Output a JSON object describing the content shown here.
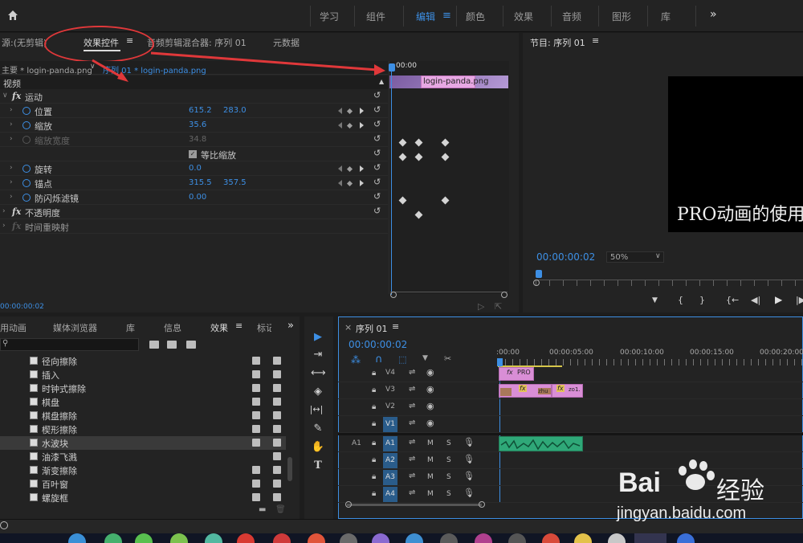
{
  "topbar": {
    "home_icon": "home-icon",
    "workspaces": [
      "学习",
      "组件",
      "编辑",
      "颜色",
      "效果",
      "音频",
      "图形",
      "库"
    ],
    "active_workspace": "编辑",
    "more": "»"
  },
  "source_panel": {
    "tabs": [
      "源:(无剪辑)",
      "效果控件",
      "音频剪辑混合器: 序列 01",
      "元数据"
    ],
    "active_tab": "效果控件",
    "menu_glyph": "≡",
    "master_clip": "主要 * login-panda.png",
    "sequence_clip": "序列 01 * login-panda.png",
    "section_video": "视频",
    "timecode_head": "00:00",
    "clip_name": "login-panda.png",
    "bottom_timecode": "00:00:00:02",
    "properties": {
      "motion": "运动",
      "position": {
        "label": "位置",
        "x": "615.2",
        "y": "283.0"
      },
      "scale": {
        "label": "缩放",
        "value": "35.6"
      },
      "scale_width": {
        "label": "缩放宽度",
        "value": "34.8"
      },
      "uniform_scale": "等比缩放",
      "rotation": {
        "label": "旋转",
        "value": "0.0"
      },
      "anchor": {
        "label": "锚点",
        "x": "315.5",
        "y": "357.5"
      },
      "antiflicker": {
        "label": "防闪烁滤镜",
        "value": "0.00"
      },
      "opacity": "不透明度",
      "time_remap": "时间重映射"
    }
  },
  "program_panel": {
    "title": "节目: 序列 01",
    "menu_glyph": "≡",
    "overlay_text": "PRO动画的使用",
    "timecode": "00:00:00:02",
    "zoom": "50%",
    "transport": [
      "▼",
      "{",
      "}",
      "{←",
      "◀|",
      "▶",
      "|▶"
    ]
  },
  "effects_panel": {
    "tabs": [
      "用动画",
      "媒体浏览器",
      "库",
      "信息",
      "效果",
      "标记"
    ],
    "active_tab": "效果",
    "menu_glyph": "≡",
    "more": "»",
    "items": [
      {
        "name": "径向擦除",
        "badges": 2
      },
      {
        "name": "插入",
        "badges": 2
      },
      {
        "name": "时钟式擦除",
        "badges": 2
      },
      {
        "name": "棋盘",
        "badges": 2
      },
      {
        "name": "棋盘擦除",
        "badges": 2
      },
      {
        "name": "楔形擦除",
        "badges": 2
      },
      {
        "name": "水波块",
        "badges": 2
      },
      {
        "name": "油漆飞溅",
        "badges": 1
      },
      {
        "name": "渐变擦除",
        "badges": 2
      },
      {
        "name": "百叶窗",
        "badges": 2
      },
      {
        "name": "螺旋框",
        "badges": 2
      }
    ],
    "selected": "水波块"
  },
  "timeline": {
    "tab": "序列 01",
    "close": "×",
    "menu_glyph": "≡",
    "timecode": "00:00:00:02",
    "ruler": [
      ":00:00",
      "00:00:05:00",
      "00:00:10:00",
      "00:00:15:00",
      "00:00:20:00"
    ],
    "video_tracks": [
      "V4",
      "V3",
      "V2",
      "V1"
    ],
    "audio_tracks": [
      "A1",
      "A2",
      "A3",
      "A4"
    ],
    "source_a1": "A1",
    "clips": {
      "v4": "PRO",
      "v3a": "zhu",
      "v3b": "zo1."
    }
  },
  "tools": [
    "▶",
    "⇥",
    "⟷",
    "◈",
    "|↔|",
    "✎",
    "✋",
    "T"
  ],
  "watermark": {
    "brand": "Bai",
    "brand_cn": "经验",
    "url": "jingyan.baidu.com"
  }
}
